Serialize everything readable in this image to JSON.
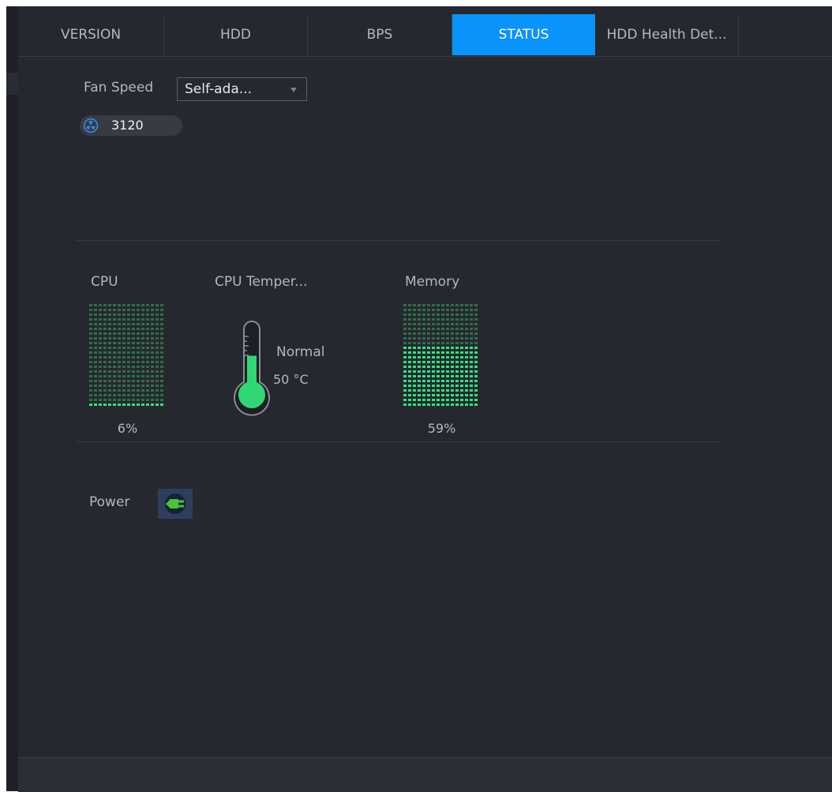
{
  "tabs": [
    {
      "label": "VERSION",
      "active": false
    },
    {
      "label": "HDD",
      "active": false
    },
    {
      "label": "BPS",
      "active": false
    },
    {
      "label": "STATUS",
      "active": true
    },
    {
      "label": "HDD Health Det...",
      "active": false
    }
  ],
  "fan": {
    "label": "Fan Speed",
    "mode_selected": "Self-ada...",
    "speed_value": "3120",
    "icon": "fan-icon"
  },
  "cpu": {
    "label": "CPU",
    "usage_text": "6%",
    "usage_fraction": 0.06
  },
  "cpu_temperature": {
    "label": "CPU Temper...",
    "status": "Normal",
    "value": "50 °C",
    "level_fraction": 0.55
  },
  "memory": {
    "label": "Memory",
    "usage_text": "59%",
    "usage_fraction": 0.59
  },
  "power": {
    "label": "Power",
    "icon": "power-plug-icon"
  },
  "colors": {
    "accent": "#0a93fb",
    "meter_on": "#2ee47a",
    "meter_off": "#2f6e4a"
  }
}
